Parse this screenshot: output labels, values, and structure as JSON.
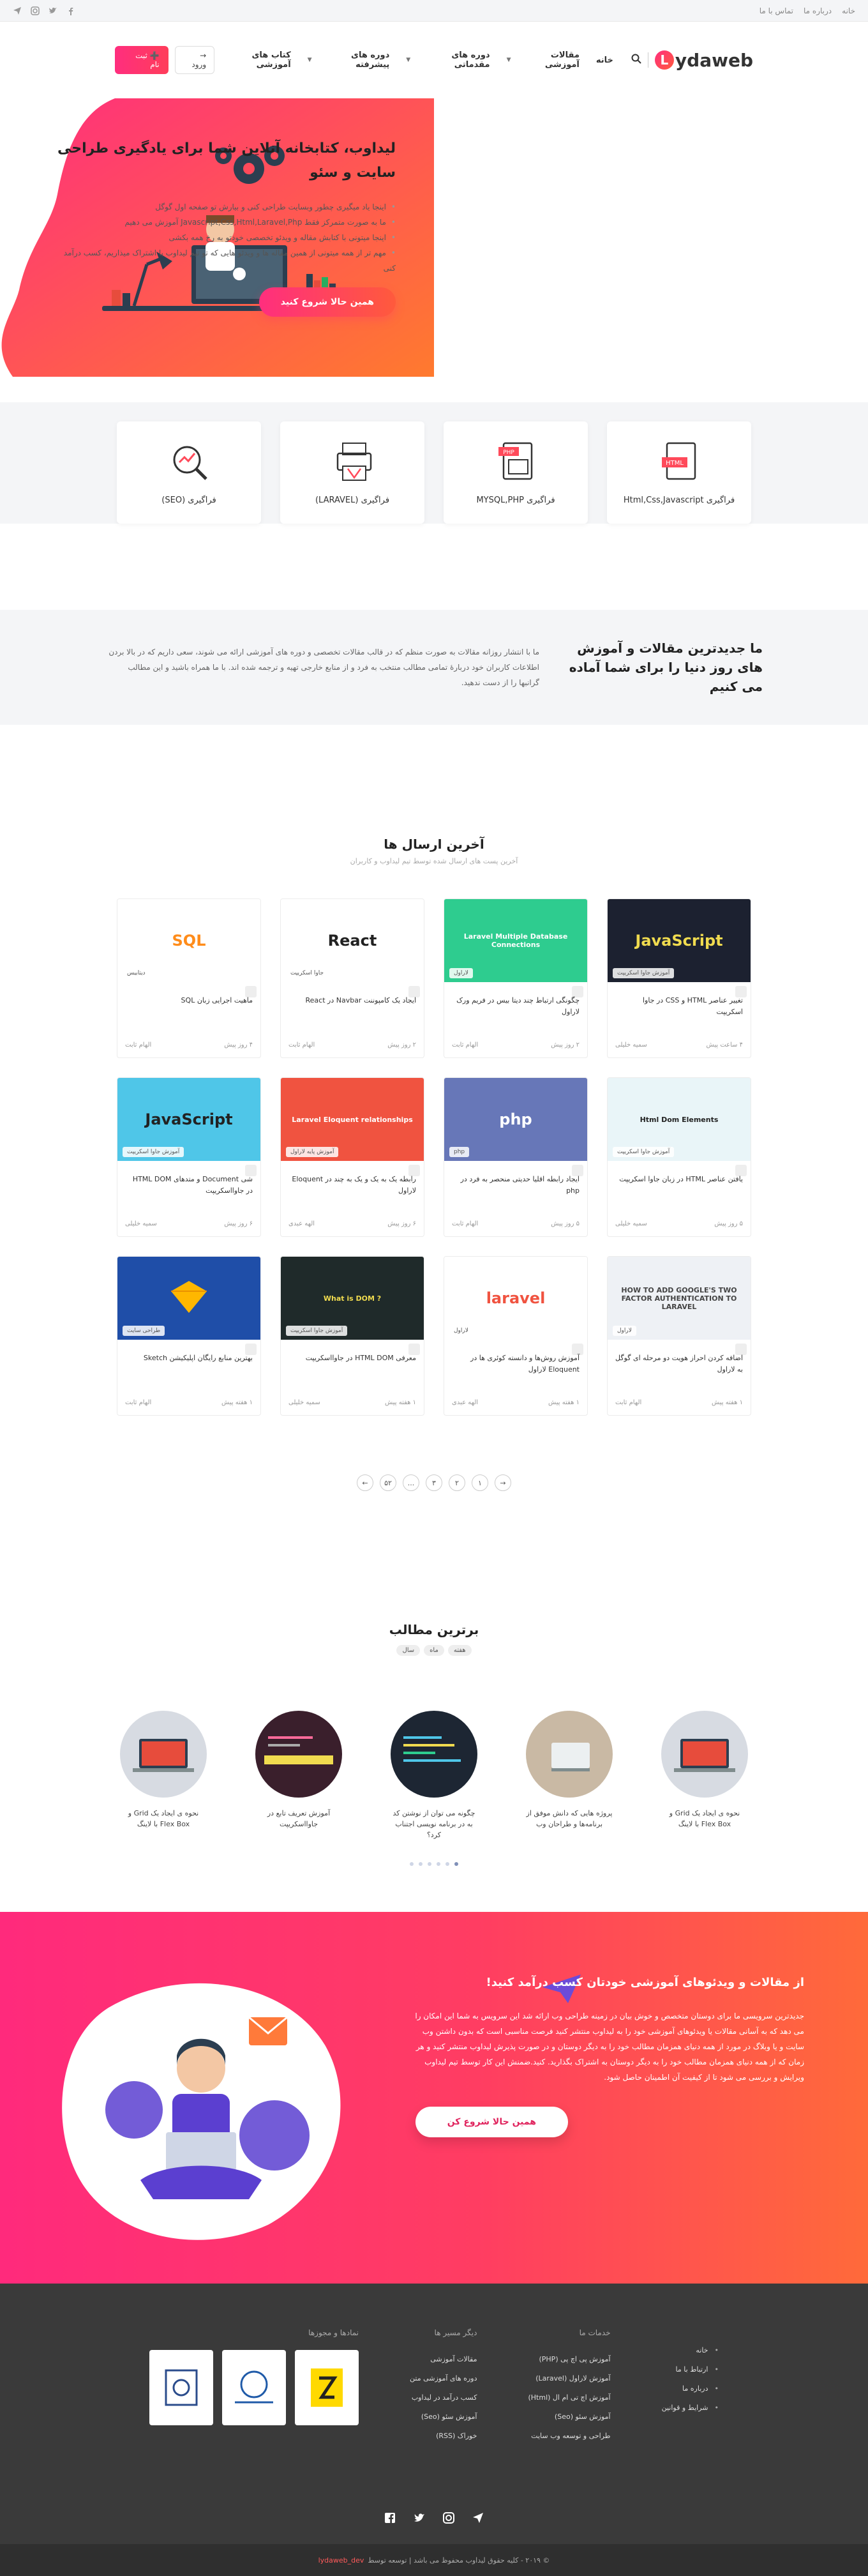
{
  "topbar": {
    "links": [
      "خانه",
      "درباره ما",
      "تماس با ما"
    ],
    "icons": [
      "send-icon",
      "instagram-icon",
      "twitter-icon",
      "facebook-icon"
    ]
  },
  "header": {
    "logo": "ydaweb",
    "logo_letter": "L",
    "nav": [
      {
        "label": "خانه",
        "chevron": false
      },
      {
        "label": "مقالات آموزشی",
        "chevron": true
      },
      {
        "label": "دوره های مقدماتی",
        "chevron": true
      },
      {
        "label": "دوره های پیشرفته",
        "chevron": true
      },
      {
        "label": "کتاب های آموزشی",
        "chevron": false
      }
    ],
    "register": "ثبت نام",
    "login": "ورود"
  },
  "hero": {
    "title": "لیداوب، کتابخانه آنلاین شما برای یادگیری طراحی سایت و سئو",
    "bullets": [
      "اینجا یاد میگیری چطور وبسایت طراحی کنی و بیارش تو صفحه اول گوگل",
      "ما به صورت متمرکز فقط Javascript,Css,Html,Laravel,Php آموزش می دهیم",
      "اینجا میتونی با کتابش مقاله و ویدئو تخصصی خودتو به رخ همه بکشی",
      "مهم تر از همه میتونی از همین مقاله ها و ویدئو هایی که تو تیم لیداوب با اشتراک میذاریم، کسب درآمد کنی"
    ],
    "cta": "همین حالا شروع کنید"
  },
  "categories": [
    {
      "label": "فراگیری Html,Css,Javascript",
      "icon": "html-file-icon"
    },
    {
      "label": "فراگیری MYSQL,PHP",
      "icon": "php-file-icon"
    },
    {
      "label": "فراگیری (LARAVEL)",
      "icon": "laravel-printer-icon"
    },
    {
      "label": "فراگیری (SEO)",
      "icon": "seo-magnifier-icon"
    }
  ],
  "intro": {
    "title": "ما جدیدترین مقالات و آموزش های روز دنیا را برای شما آماده می کنیم",
    "text": "ما با انتشار روزانه مقالات به صورت منظم که در قالب مقالات تخصصی و دوره های آموزشی ارائه می شوند، سعی داریم که در بالا بردن اطلاعات کاربران خود دربارهٔ تمامی مطالب منتخب به فرد و از منابع خارجی تهیه و ترجمه شده اند. با ما همراه باشید و این مطالب گرانبها را از دست ندهید."
  },
  "latest": {
    "title": "آخرین ارسال ها",
    "subtitle": "آخرین پست های ارسال شده توسط تیم لیداوب و کاربران",
    "posts": [
      {
        "title": "تغییر عناصر HTML و CSS در جاوا اسکریپت",
        "author": "سمیه خلیلی",
        "date": "۴ ساعت پیش",
        "badge": "آموزش جاوا اسکریپت",
        "theme": "js-dark",
        "thumb_text": "JavaScript"
      },
      {
        "title": "چگونگی ارتباط چند دیتا بیس در فریم ورک لاراول",
        "author": "الهام ثابت",
        "date": "۲ روز پیش",
        "badge": "لاراول",
        "theme": "laravel-green",
        "thumb_text": "Laravel Multiple Database Connections"
      },
      {
        "title": "ایجاد یک کامپوننت Navbar در React",
        "author": "الهام ثابت",
        "date": "۲ روز پیش",
        "badge": "جاوا اسکریپت",
        "theme": "react-white",
        "thumb_text": "React"
      },
      {
        "title": "ماهیت اجرایی زبان SQL",
        "author": "الهام ثابت",
        "date": "۴ روز پیش",
        "badge": "دیتابیس",
        "theme": "sql-white",
        "thumb_text": "SQL"
      },
      {
        "title": "یافتن عناصر HTML در زبان جاوا اسکریپت",
        "author": "سمیه خلیلی",
        "date": "۵ روز پیش",
        "badge": "آموزش جاوا اسکریپت",
        "theme": "js-yellow",
        "thumb_text": "Html Dom Elements"
      },
      {
        "title": "ایجاد رابطه اقلیا حدیتی منحصر به فرد در php",
        "author": "الهام ثابت",
        "date": "۵ روز پیش",
        "badge": "php",
        "theme": "php-blue",
        "thumb_text": "php"
      },
      {
        "title": "رابطه یک به یک و یک به چند در Eloquent لاراول",
        "author": "الهه عبدی",
        "date": "۶ روز پیش",
        "badge": "آموزش پایه لاراول",
        "theme": "laravel-red",
        "thumb_text": "Laravel Eloquent relationships"
      },
      {
        "title": "شی Document و متدهای HTML DOM در جاوااسکریپت",
        "author": "سمیه خلیلی",
        "date": "۶ روز پیش",
        "badge": "آموزش جاوا اسکریپت",
        "theme": "js-cyan",
        "thumb_text": "JavaScript"
      },
      {
        "title": "اضافه کردن احراز هویت دو مرحله ای گوگل به لاراول",
        "author": "الهام ثابت",
        "date": "۱ هفته پیش",
        "badge": "لاراول",
        "theme": "auth-light",
        "thumb_text": "HOW TO ADD GOOGLE'S TWO FACTOR AUTHENTICATION TO LARAVEL"
      },
      {
        "title": "آموزش روش‌ها و دانسته کوئری ها در Eloquent لاراول",
        "author": "الهه عبدی",
        "date": "۱ هفته پیش",
        "badge": "لاراول",
        "theme": "laravel-white",
        "thumb_text": "laravel"
      },
      {
        "title": "معرفی HTML DOM در جاوااسکریپت",
        "author": "سمیه خلیلی",
        "date": "۱ هفته پیش",
        "badge": "آموزش جاوا اسکریپت",
        "theme": "dom-dark",
        "thumb_text": "What is DOM ?"
      },
      {
        "title": "بهترین منابع رایگان اپلیکیشن Sketch",
        "author": "الهام ثابت",
        "date": "۱ هفته پیش",
        "badge": "طراحی سایت",
        "theme": "sketch-blue",
        "thumb_text": ""
      }
    ]
  },
  "pager": [
    "→",
    "۱",
    "۲",
    "۳",
    "...",
    "۵۲",
    "←"
  ],
  "top": {
    "title": "برترین مطالب",
    "tabs": [
      "هفته",
      "ماه",
      "سال"
    ],
    "items": [
      {
        "title": "نحوه ی ایجاد یک Grid و Flex Box با لاینگ",
        "theme": "laptop-grey"
      },
      {
        "title": "پروژه هایی که دانش موفق از برنامه‌ها و طراحان وب",
        "theme": "desk-light"
      },
      {
        "title": "چگونه می توان از نوشتن کد به در برنامه نویسی اجتناب کرد؟",
        "theme": "code-dark"
      },
      {
        "title": "آموزش تعریف تابع در جاوااسکریپت",
        "theme": "fn-dark"
      },
      {
        "title": "نحوه ی ایجاد یک Grid و Flex Box با لاینگ",
        "theme": "laptop-grey"
      }
    ],
    "dots": 6,
    "active_dot": 0
  },
  "promo": {
    "title": "از مقالات و ویدئوهای آموزشی خودتان کسب درآمد کنید!",
    "text": "جدیدترین سرویسی ما برای دوستان متخصص و خوش بیان در زمینه طراحی وب ارائه شد این سرویس به شما این امکان را می دهد که به آسانی مقالات یا ویدئوهای آموزشی خود را به لیداوب منتشر کنید فرصت مناسبی است که بدون داشتن وب سایت و یا وبلاگ در مورد از همه دنیای همزمان مطالب خود را به دیگر دوستان و در صورت پذیرش لیداوب منتشر کنید و هر زمان که از همه دنیای همزمان مطالب خود را به دیگر دوستان به اشتراک بگذارید. کنید.ضمنش این کار توسط تیم لیداوب ویرایش و بررسی می شود تا از کیفیت آن اطمینان حاصل شود.",
    "cta": "همین حالا شروع کن"
  },
  "footer": {
    "col1": {
      "title": "",
      "items": [
        "خانه",
        "ارتباط با ما",
        "درباره ما",
        "شرایط و قوانین"
      ]
    },
    "col2": {
      "title": "خدمات ما",
      "items": [
        "آموزش پی اچ پی (PHP)",
        "آموزش لاراول (Laravel)",
        "آموزش اچ تی ام ال (Html)",
        "آموزش سئو (Seo)",
        "طراحی و توسعه وب سایت"
      ]
    },
    "col3": {
      "title": "دیگر مسیر ها",
      "items": [
        "مقالات آموزشی",
        "دوره های آموزشی متن",
        "کسب درآمد در لیداوب",
        "آموزش سئو (Seo)",
        "خوراک (RSS)"
      ]
    },
    "col4": {
      "title": "نمادها و مجوزها"
    },
    "copyright": "© ۲۰۱۹ - کلیه حقوق لیداوب محفوظ می باشد | توسعه توسط",
    "dev": "lydaweb_dev"
  },
  "colors": {
    "accent": "#ff2e7e",
    "accent2": "#ff5a3c",
    "footer": "#3a3a3a"
  }
}
